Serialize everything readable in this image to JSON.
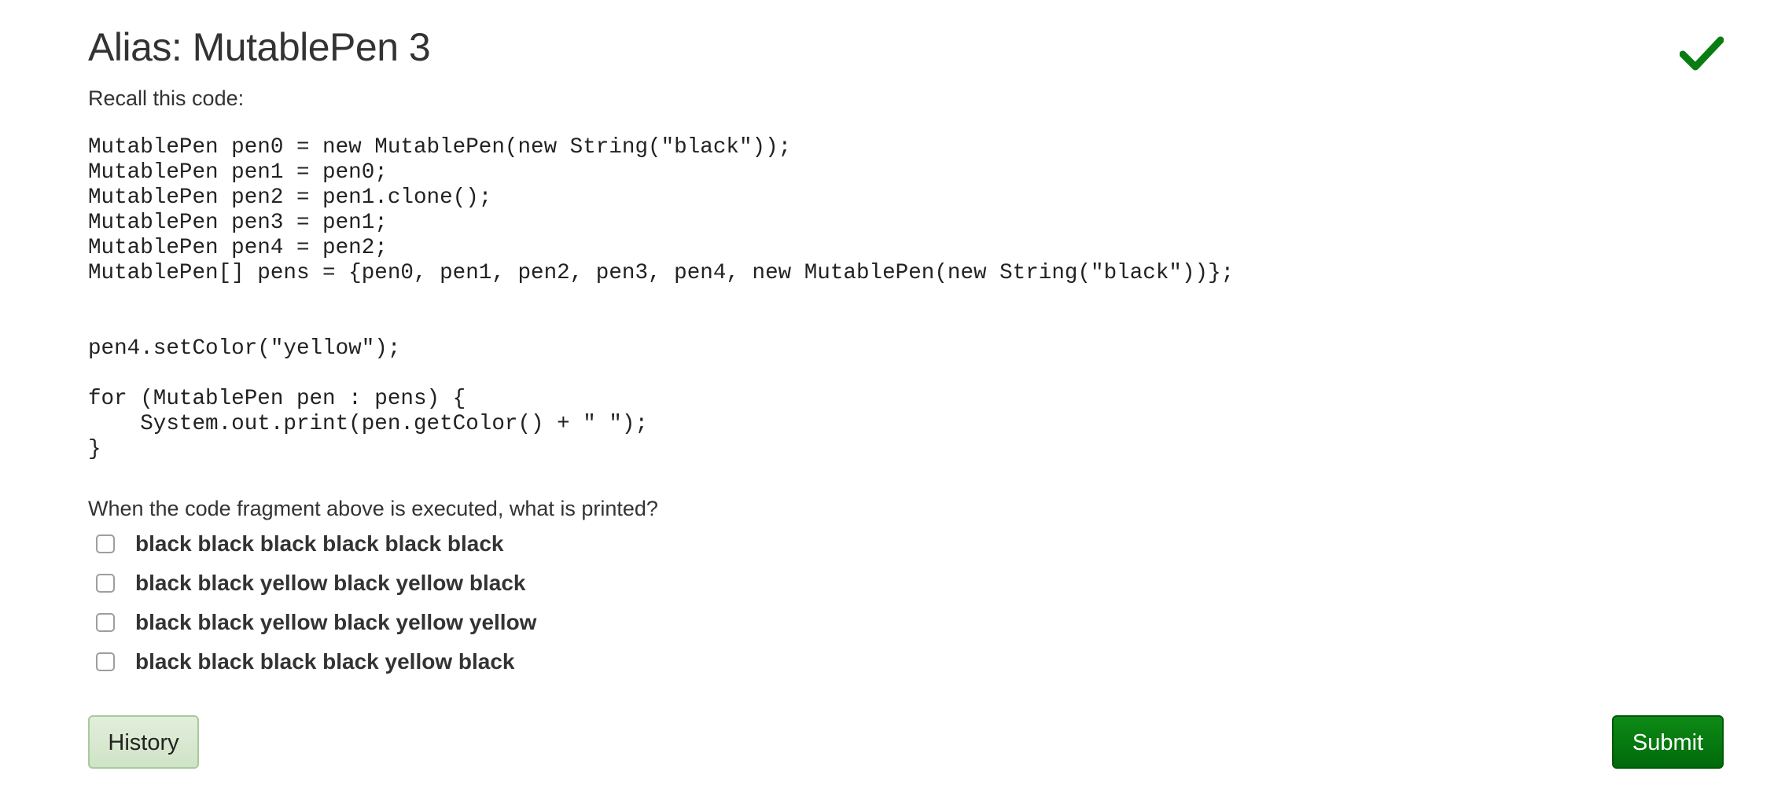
{
  "question": {
    "title": "Alias: MutablePen 3",
    "recall_label": "Recall this code:",
    "code": "MutablePen pen0 = new MutablePen(new String(\"black\"));\nMutablePen pen1 = pen0;\nMutablePen pen2 = pen1.clone();\nMutablePen pen3 = pen1;\nMutablePen pen4 = pen2;\nMutablePen[] pens = {pen0, pen1, pen2, pen3, pen4, new MutablePen(new String(\"black\"))};\n\n\npen4.setColor(\"yellow\");\n\nfor (MutablePen pen : pens) {\n    System.out.print(pen.getColor() + \" \");\n}",
    "prompt": "When the code fragment above is executed, what is printed?",
    "options": [
      {
        "label": "black black black black black black",
        "checked": false
      },
      {
        "label": "black black yellow black yellow black",
        "checked": false
      },
      {
        "label": "black black yellow black yellow yellow",
        "checked": false
      },
      {
        "label": "black black black black yellow black",
        "checked": false
      }
    ],
    "status_icon": "checkmark-icon"
  },
  "buttons": {
    "history_label": "History",
    "submit_label": "Submit"
  },
  "colors": {
    "check": "#0a7d12",
    "submit_bg": "#007a10",
    "history_bg": "#d8e9d0",
    "text": "#333333"
  }
}
